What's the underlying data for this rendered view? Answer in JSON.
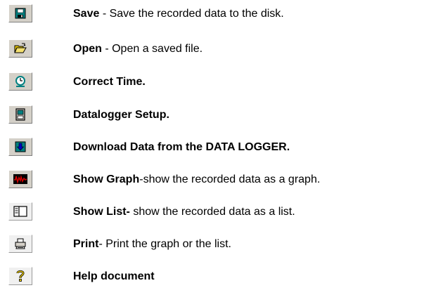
{
  "items": [
    {
      "icon": "save-icon",
      "label": "Save",
      "rest": " - Save the recorded data to the disk."
    },
    {
      "icon": "open-folder-icon",
      "label": "Open",
      "rest": " - Open a saved file."
    },
    {
      "icon": "clock-icon",
      "label": "Correct Time.",
      "rest": ""
    },
    {
      "icon": "datalogger-icon",
      "label": "Datalogger Setup.",
      "rest": ""
    },
    {
      "icon": "download-icon",
      "label": "Download Data from the DATA LOGGER.",
      "rest": ""
    },
    {
      "icon": "graph-icon",
      "label": "Show Graph",
      "rest": "-show the recorded data as a graph."
    },
    {
      "icon": "list-icon",
      "label": "Show List-",
      "rest": " show the recorded data as a list."
    },
    {
      "icon": "printer-icon",
      "label": "Print",
      "rest": "- Print the graph or the list."
    },
    {
      "icon": "help-icon",
      "label": "Help document",
      "rest": ""
    }
  ],
  "colors": {
    "button_face": "#d4d0c8",
    "icon_teal": "#008080",
    "icon_blue": "#0000c0",
    "icon_red": "#d00000",
    "icon_yellow": "#e8c800"
  }
}
